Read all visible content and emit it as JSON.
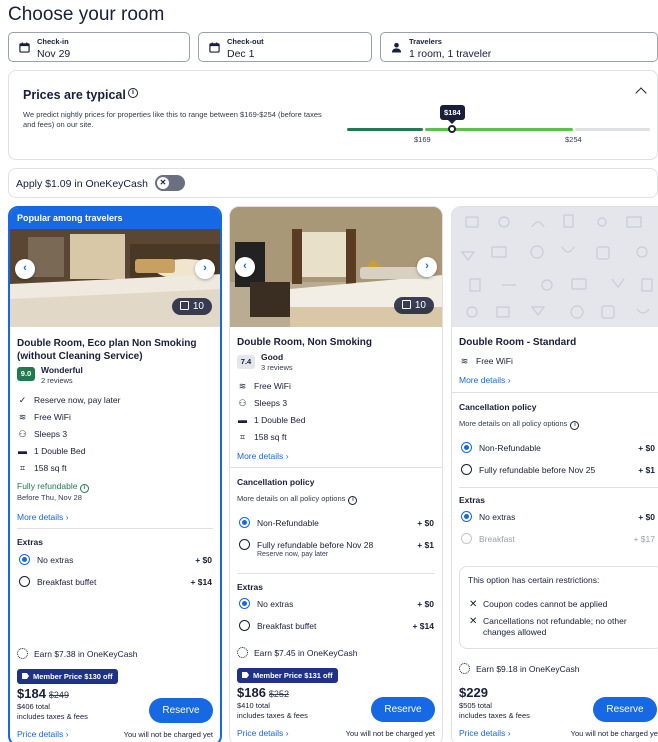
{
  "page": {
    "title": "Choose your room"
  },
  "search": {
    "checkin": {
      "label": "Check-in",
      "value": "Nov 29"
    },
    "checkout": {
      "label": "Check-out",
      "value": "Dec 1"
    },
    "travelers": {
      "label": "Travelers",
      "value": "1 room, 1 traveler"
    }
  },
  "prices_panel": {
    "title": "Prices are typical",
    "description": "We predict nightly prices for properties like this to range between $169-$254 (before taxes and fees) on our site.",
    "current": "$184",
    "low": "$169",
    "high": "$254",
    "colors": {
      "low": "#227950",
      "typical": "#5fbf4b",
      "high": "#dfe0e4"
    }
  },
  "onekeycash": {
    "label": "Apply $1.09 in OneKeyCash",
    "toggle_on": false
  },
  "rooms": [
    {
      "banner": "Popular among travelers",
      "photo_count": "10",
      "name": "Double Room, Eco plan Non Smoking (without Cleaning Service)",
      "rating": "9.0",
      "rating_word": "Wonderful",
      "reviews": "2 reviews",
      "features": [
        "Reserve now, pay later",
        "Free WiFi",
        "Sleeps 3",
        "1 Double Bed",
        "158 sq ft"
      ],
      "refundable": "Fully refundable",
      "refundable_until": "Before Thu, Nov 28",
      "more_details": "More details",
      "extras_title": "Extras",
      "extras": [
        {
          "label": "No extras",
          "price": "+ $0",
          "selected": true
        },
        {
          "label": "Breakfast buffet",
          "price": "+ $14",
          "selected": false
        }
      ],
      "earn": "Earn $7.38 in OneKeyCash",
      "member_price": "Member Price $130 off",
      "price": "$184",
      "old_price": "$249",
      "total": "$406 total",
      "taxes": "includes taxes & fees",
      "reserve": "Reserve",
      "price_details": "Price details",
      "no_charge": "You will not be charged yet"
    },
    {
      "photo_count": "10",
      "name": "Double Room, Non Smoking",
      "rating": "7.4",
      "rating_word": "Good",
      "reviews": "3 reviews",
      "features": [
        "Free WiFi",
        "Sleeps 3",
        "1 Double Bed",
        "158 sq ft"
      ],
      "more_details": "More details",
      "cancel_title": "Cancellation policy",
      "cancel_sub": "More details on all policy options",
      "cancel": [
        {
          "label": "Non-Refundable",
          "price": "+ $0",
          "selected": true
        },
        {
          "label": "Fully refundable before Nov 28",
          "price": "+ $1",
          "sub": "Reserve now, pay later",
          "selected": false
        }
      ],
      "extras_title": "Extras",
      "extras": [
        {
          "label": "No extras",
          "price": "+ $0",
          "selected": true
        },
        {
          "label": "Breakfast buffet",
          "price": "+ $14",
          "selected": false
        }
      ],
      "earn": "Earn $7.45 in OneKeyCash",
      "member_price": "Member Price $131 off",
      "price": "$186",
      "old_price": "$252",
      "total": "$410 total",
      "taxes": "includes taxes & fees",
      "reserve": "Reserve",
      "price_details": "Price details",
      "no_charge": "You will not be charged yet"
    },
    {
      "name": "Double Room - Standard",
      "features": [
        "Free WiFi"
      ],
      "more_details": "More details",
      "cancel_title": "Cancellation policy",
      "cancel_sub": "More details on all policy options",
      "cancel": [
        {
          "label": "Non-Refundable",
          "price": "+ $0",
          "selected": true
        },
        {
          "label": "Fully refundable before Nov 25",
          "price": "+ $1",
          "selected": false
        }
      ],
      "extras_title": "Extras",
      "extras": [
        {
          "label": "No extras",
          "price": "+ $0",
          "selected": true
        },
        {
          "label": "Breakfast",
          "price": "+ $17",
          "selected": false,
          "disabled": true
        }
      ],
      "restrictions_title": "This option has certain restrictions:",
      "restrictions": [
        "Coupon codes cannot be applied",
        "Cancellations not refundable; no other changes allowed"
      ],
      "earn": "Earn $9.18 in OneKeyCash",
      "price": "$229",
      "total": "$505 total",
      "taxes": "includes taxes & fees",
      "reserve": "Reserve",
      "price_details": "Price details",
      "no_charge": "You will not be charged yet"
    }
  ],
  "colors": {
    "accent": "#1668e3",
    "dark": "#191e3b",
    "rating_green": "#227950",
    "member": "#1f3287"
  }
}
